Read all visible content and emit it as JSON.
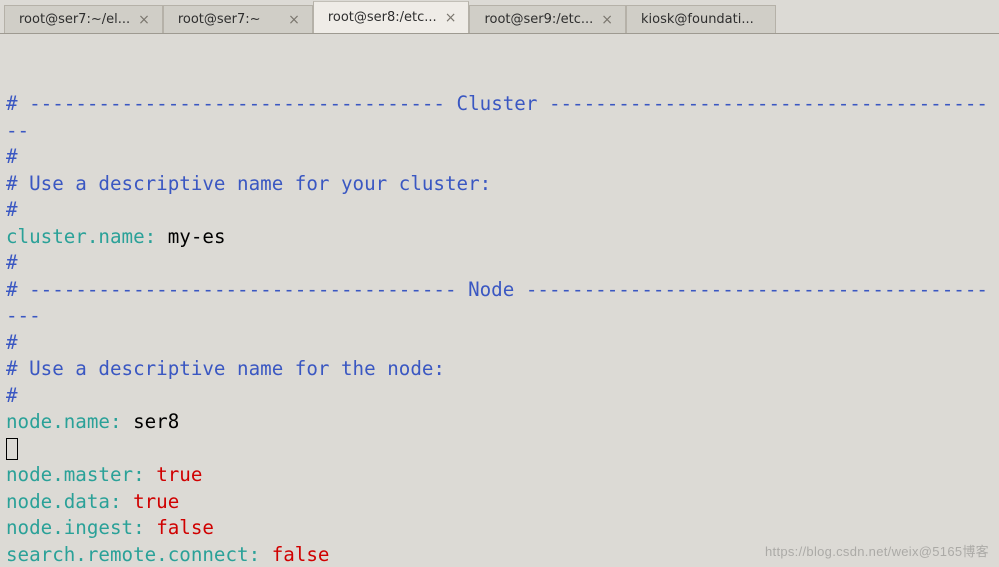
{
  "tabs": [
    {
      "label": "root@ser7:~/el...",
      "active": false,
      "closeable": true
    },
    {
      "label": "root@ser7:~",
      "active": false,
      "closeable": true
    },
    {
      "label": "root@ser8:/etc...",
      "active": true,
      "closeable": true
    },
    {
      "label": "root@ser9:/etc...",
      "active": false,
      "closeable": true
    },
    {
      "label": "kiosk@foundati...",
      "active": false,
      "closeable": false
    }
  ],
  "tab_close_glyph": "×",
  "config_lines": [
    {
      "type": "section",
      "prefix": "# ",
      "dash_left": "------------------------------------",
      "title": " Cluster ",
      "dash_right": "----------------------------------------"
    },
    {
      "type": "comment",
      "text": "#"
    },
    {
      "type": "comment",
      "text": "# Use a descriptive name for your cluster:"
    },
    {
      "type": "comment",
      "text": "#"
    },
    {
      "type": "kv",
      "key": "cluster.name",
      "sep": ": ",
      "value": "my-es",
      "value_kind": "text"
    },
    {
      "type": "comment",
      "text": "#"
    },
    {
      "type": "section",
      "prefix": "# ",
      "dash_left": "-------------------------------------",
      "title": " Node ",
      "dash_right": "-------------------------------------------"
    },
    {
      "type": "comment",
      "text": "#"
    },
    {
      "type": "comment",
      "text": "# Use a descriptive name for the node:"
    },
    {
      "type": "comment",
      "text": "#"
    },
    {
      "type": "kv",
      "key": "node.name",
      "sep": ": ",
      "value": "ser8",
      "value_kind": "text"
    },
    {
      "type": "cursor"
    },
    {
      "type": "kv",
      "key": "node.master",
      "sep": ": ",
      "value": "true",
      "value_kind": "bool"
    },
    {
      "type": "kv",
      "key": "node.data",
      "sep": ": ",
      "value": "true",
      "value_kind": "bool"
    },
    {
      "type": "kv",
      "key": "node.ingest",
      "sep": ": ",
      "value": "false",
      "value_kind": "bool"
    },
    {
      "type": "kv",
      "key": "search.remote.connect",
      "sep": ": ",
      "value": "false",
      "value_kind": "bool"
    }
  ],
  "watermark": "https://blog.csdn.net/weix@5165博客"
}
